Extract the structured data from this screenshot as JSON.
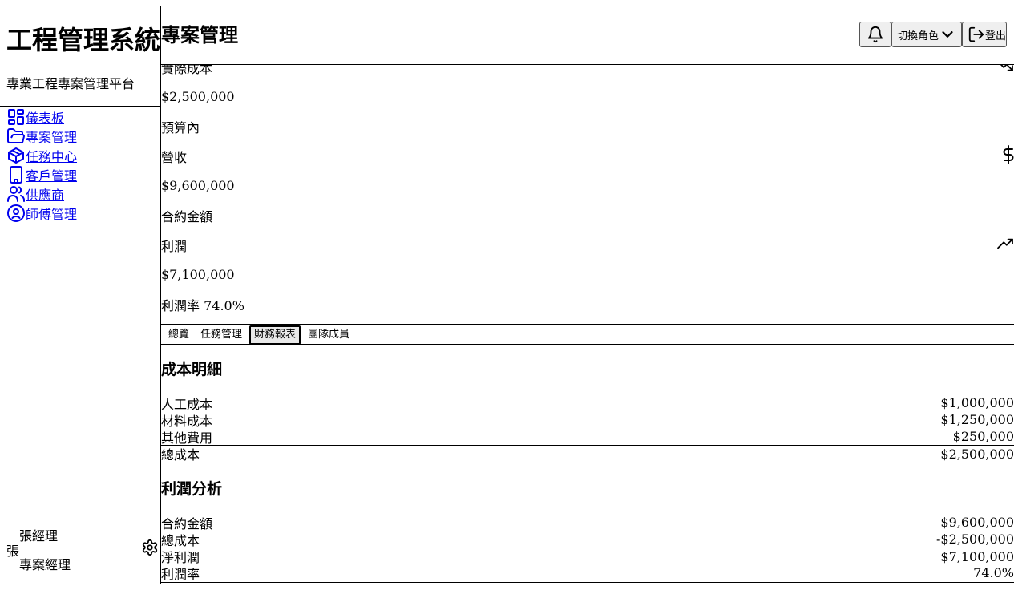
{
  "app": {
    "title": "工程管理系統",
    "subtitle": "專業工程專案管理平台"
  },
  "sidebar": {
    "items": [
      {
        "label": "儀表板",
        "icon": "dashboard-icon"
      },
      {
        "label": "專案管理",
        "icon": "folder-icon"
      },
      {
        "label": "任務中心",
        "icon": "box-icon"
      },
      {
        "label": "客戶管理",
        "icon": "building-icon"
      },
      {
        "label": "供應商",
        "icon": "users-icon"
      },
      {
        "label": "師傅管理",
        "icon": "user-circle-icon"
      }
    ],
    "user": {
      "initial": "張",
      "name": "張經理",
      "role": "專案經理"
    }
  },
  "header": {
    "title": "專案管理",
    "switch_role_label": "切換角色",
    "logout_label": "登出"
  },
  "stats": {
    "actual_cost": {
      "label": "實際成本",
      "value": "$2,500,000",
      "note": "預算內"
    },
    "revenue": {
      "label": "營收",
      "value": "$9,600,000",
      "note": "合約金額"
    },
    "profit": {
      "label": "利潤",
      "value": "$7,100,000",
      "note": "利潤率 74.0%"
    }
  },
  "tabs": [
    {
      "label": "總覽",
      "active": false
    },
    {
      "label": "任務管理",
      "active": false
    },
    {
      "label": "財務報表",
      "active": true
    },
    {
      "label": "團隊成員",
      "active": false
    }
  ],
  "finance": {
    "cost_title": "成本明細",
    "cost_rows": [
      {
        "label": "人工成本",
        "value": "$1,000,000"
      },
      {
        "label": "材料成本",
        "value": "$1,250,000"
      },
      {
        "label": "其他費用",
        "value": "$250,000"
      }
    ],
    "cost_total": {
      "label": "總成本",
      "value": "$2,500,000"
    },
    "profit_title": "利潤分析",
    "profit_rows": [
      {
        "label": "合約金額",
        "value": "$9,600,000"
      },
      {
        "label": "總成本",
        "value": "-$2,500,000"
      }
    ],
    "profit_totals": [
      {
        "label": "淨利潤",
        "value": "$7,100,000"
      },
      {
        "label": "利潤率",
        "value": "74.0%"
      }
    ]
  }
}
